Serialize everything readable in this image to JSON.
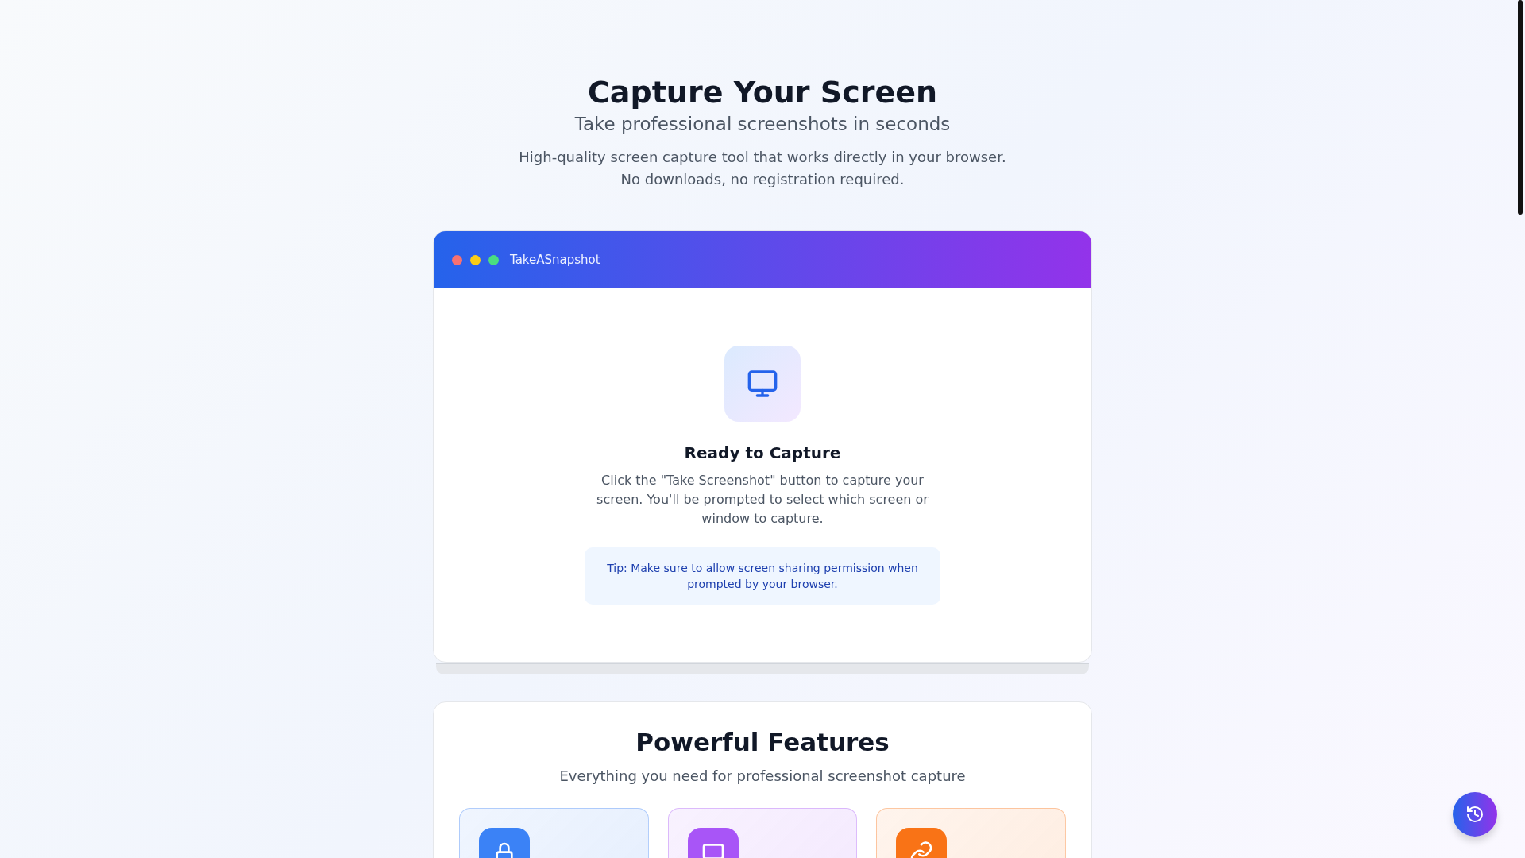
{
  "hero": {
    "title": "Capture Your Screen",
    "subtitle": "Take professional screenshots in seconds",
    "description": "High-quality screen capture tool that works directly in your browser. No downloads, no registration required."
  },
  "app_window": {
    "dots": [
      {
        "color": "#f87171"
      },
      {
        "color": "#facc15"
      },
      {
        "color": "#4ade80"
      }
    ],
    "title": "TakeASnapshot",
    "heading": "Ready to Capture",
    "message": "Click the \"Take Screenshot\" button to capture your screen. You'll be prompted to select which screen or window to capture.",
    "tip": "Tip: Make sure to allow screen sharing permission when prompted by your browser."
  },
  "features": {
    "title": "Powerful Features",
    "subtitle": "Everything you need for professional screenshot capture",
    "cards": [
      {
        "kind": "lock",
        "color": "#3b82f6"
      },
      {
        "kind": "screen",
        "color": "#a855f7"
      },
      {
        "kind": "link",
        "color": "#f97316"
      }
    ]
  }
}
